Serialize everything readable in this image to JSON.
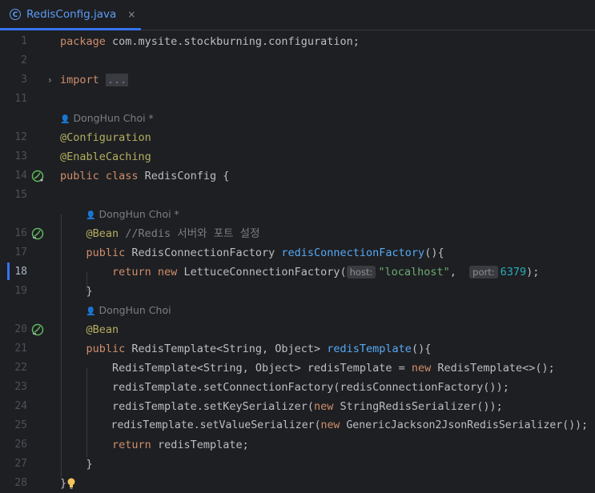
{
  "tab": {
    "label": "RedisConfig.java",
    "icon": "class-c-icon",
    "close": "×"
  },
  "annotations": {
    "author1": "DongHun Choi *",
    "author2": "DongHun Choi *",
    "author3": "DongHun Choi"
  },
  "lines": [
    {
      "n": "1"
    },
    {
      "n": "2"
    },
    {
      "n": "3"
    },
    {
      "n": "11"
    },
    {
      "n": "12"
    },
    {
      "n": "13"
    },
    {
      "n": "14"
    },
    {
      "n": "15"
    },
    {
      "n": "16"
    },
    {
      "n": "17"
    },
    {
      "n": "18"
    },
    {
      "n": "19"
    },
    {
      "n": "20"
    },
    {
      "n": "21"
    },
    {
      "n": "22"
    },
    {
      "n": "23"
    },
    {
      "n": "24"
    },
    {
      "n": "25"
    },
    {
      "n": "26"
    },
    {
      "n": "27"
    },
    {
      "n": "28"
    }
  ],
  "code": {
    "l1_kw": "package",
    "l1_rest": " com.mysite.stockburning.configuration;",
    "l3_kw": "import",
    "l3_fold": "...",
    "l12": "@Configuration",
    "l13": "@EnableCaching",
    "l14_kw": "public class",
    "l14_rest": " RedisConfig {",
    "l16_ann": "@Bean",
    "l16_cm": " //Redis 서버와 포트 설정",
    "l17_kw": "public",
    "l17_type": " RedisConnectionFactory ",
    "l17_fn": "redisConnectionFactory",
    "l17_rest": "(){",
    "l18_kw": "return new",
    "l18_type": " LettuceConnectionFactory(",
    "l18_hint1": "host:",
    "l18_str": "\"localhost\"",
    "l18_comma": ",  ",
    "l18_hint2": "port:",
    "l18_num": "6379",
    "l18_end": ");",
    "l19": "}",
    "l20_ann": "@Bean",
    "l21_kw": "public",
    "l21_type": " RedisTemplate<String, Object> ",
    "l21_fn": "redisTemplate",
    "l21_rest": "(){",
    "l22_a": "RedisTemplate<String, Object> redisTemplate = ",
    "l22_kw": "new",
    "l22_b": " RedisTemplate<>();",
    "l23": "redisTemplate.setConnectionFactory(redisConnectionFactory());",
    "l24_a": "redisTemplate.setKeySerializer(",
    "l24_kw": "new",
    "l24_b": " StringRedisSerializer());",
    "l25_a": "redisTemplate.setValueSerializer(",
    "l25_kw": "new",
    "l25_b": " GenericJackson2JsonRedisSerializer());",
    "l26_kw": "return",
    "l26_rest": " redisTemplate;",
    "l27": "}",
    "l28": "}"
  },
  "colors": {
    "accent": "#3574f0",
    "keyword": "#cf8e6d",
    "annotation": "#b3ae60",
    "function": "#56a8f5",
    "string": "#6aab73",
    "number": "#2aacb8"
  }
}
